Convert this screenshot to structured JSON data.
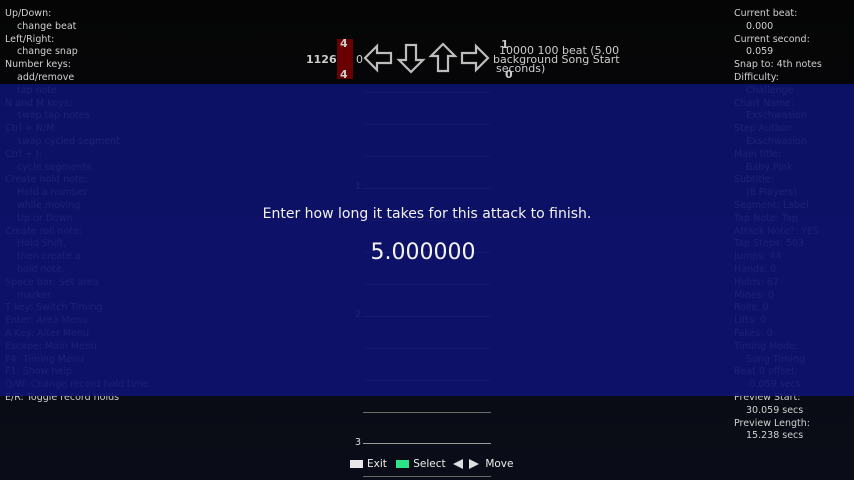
{
  "help_left": [
    {
      "text": "Up/Down:",
      "indent": false
    },
    {
      "text": "change beat",
      "indent": true
    },
    {
      "text": "Left/Right:",
      "indent": false
    },
    {
      "text": "change snap",
      "indent": true
    },
    {
      "text": "Number keys:",
      "indent": false
    },
    {
      "text": "add/remove",
      "indent": true
    },
    {
      "text": "tap note",
      "indent": true
    },
    {
      "text": "N and M keys:",
      "indent": false
    },
    {
      "text": "swap tap notes",
      "indent": true
    },
    {
      "text": "Ctrl + N/M:",
      "indent": false
    },
    {
      "text": "swap cycled segment",
      "indent": true
    },
    {
      "text": "Ctrl + J:",
      "indent": false
    },
    {
      "text": "cycle segments",
      "indent": true
    },
    {
      "text": "Create hold note:",
      "indent": false
    },
    {
      "text": "Hold a number",
      "indent": true
    },
    {
      "text": "while moving",
      "indent": true
    },
    {
      "text": "Up or Down",
      "indent": true
    },
    {
      "text": "Create roll note:",
      "indent": false
    },
    {
      "text": "Hold Shift,",
      "indent": true
    },
    {
      "text": "then create a",
      "indent": true
    },
    {
      "text": "hold note.",
      "indent": true
    },
    {
      "text": "Space bar: Set area",
      "indent": false
    },
    {
      "text": "marker",
      "indent": true
    },
    {
      "text": "T key: Switch Timing",
      "indent": false
    },
    {
      "text": "Enter: Area Menu",
      "indent": false
    },
    {
      "text": "A Key: Alter Menu",
      "indent": false
    },
    {
      "text": "Escape: Main Menu",
      "indent": false
    },
    {
      "text": "F4: Timing Menu",
      "indent": false
    },
    {
      "text": "F1: Show help",
      "indent": false
    },
    {
      "text": "Q/W: Change record hold time",
      "indent": false
    },
    {
      "text": "E/R: Toggle record holds",
      "indent": false
    }
  ],
  "help_right": [
    {
      "text": "Current beat:",
      "indent": false
    },
    {
      "text": "0.000",
      "indent": true
    },
    {
      "text": "Current second:",
      "indent": false
    },
    {
      "text": "0.059",
      "indent": true
    },
    {
      "text": "Snap to: 4th notes",
      "indent": false
    },
    {
      "text": "Difficulty:",
      "indent": false
    },
    {
      "text": "Challenge",
      "indent": true
    },
    {
      "text": "Chart Name:",
      "indent": false
    },
    {
      "text": "Exschwasion",
      "indent": true
    },
    {
      "text": "Step Author:",
      "indent": false
    },
    {
      "text": "Exschwasion",
      "indent": true
    },
    {
      "text": "Main title:",
      "indent": false
    },
    {
      "text": "Baby Pink",
      "indent": true
    },
    {
      "text": "Subtitle:",
      "indent": false
    },
    {
      "text": "(8 Players)",
      "indent": true
    },
    {
      "text": "Segment: Label",
      "indent": false
    },
    {
      "text": "Tap Note: Tap",
      "indent": false
    },
    {
      "text": "Attack Note?: YES",
      "indent": false
    },
    {
      "text": "Tap Steps: 503",
      "indent": false
    },
    {
      "text": "Jumps: 44",
      "indent": false
    },
    {
      "text": "Hands: 0",
      "indent": false
    },
    {
      "text": "Holds: 87",
      "indent": false
    },
    {
      "text": "Mines: 0",
      "indent": false
    },
    {
      "text": "Rolls: 0",
      "indent": false
    },
    {
      "text": "Lifts: 0",
      "indent": false
    },
    {
      "text": "Fakes: 0",
      "indent": false
    },
    {
      "text": "Timing Mode:",
      "indent": false
    },
    {
      "text": "Song Timing",
      "indent": true
    },
    {
      "text": "Beat 0 offset:",
      "indent": false
    },
    {
      "text": "-0.059 secs",
      "indent": true
    },
    {
      "text": "Preview Start:",
      "indent": false
    },
    {
      "text": "30.059 secs",
      "indent": true
    },
    {
      "text": "Preview Length:",
      "indent": false
    },
    {
      "text": "15.238 secs",
      "indent": true
    }
  ],
  "receptor": {
    "bpm_value": "1126",
    "bpm_beat": "0",
    "time_sig_top": "4",
    "time_sig_bottom": "4",
    "right_info_line1": "10000 100 beat (5.00",
    "right_info_line2": "background Song Start",
    "right_info_line3": "seconds)",
    "right_top_num": "1",
    "right_bottom_num": "0"
  },
  "beat_labels": [
    "1",
    "2",
    "3"
  ],
  "dialog": {
    "prompt": "Enter how long it takes for this attack to finish.",
    "value": "5.000000"
  },
  "footer": {
    "exit_label": "Exit",
    "select_label": "Select",
    "move_label": "Move",
    "exit_color": "#e8e8e8",
    "select_color": "#2ee68a"
  },
  "colors": {
    "overlay": "#0e126e",
    "time_signature": "#7a0000"
  },
  "icons": [
    "left-arrow-icon",
    "down-arrow-icon",
    "up-arrow-icon",
    "right-arrow-icon"
  ]
}
